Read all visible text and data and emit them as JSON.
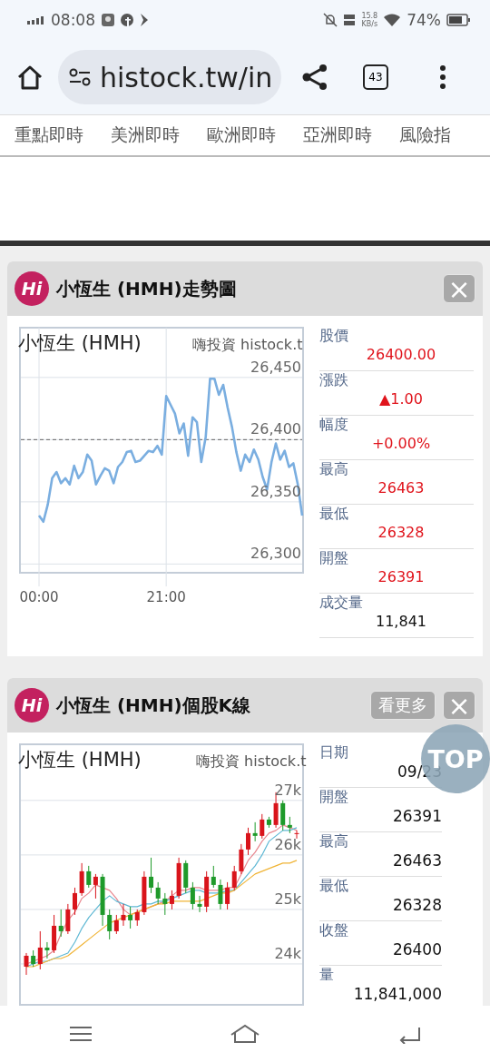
{
  "status_bar": {
    "time": "08:08",
    "speed_value": "15.8",
    "speed_unit": "KB/s",
    "battery": "74%"
  },
  "browser": {
    "url": "histock.tw/in",
    "tab_count": "43"
  },
  "nav_tabs": [
    {
      "label": "重點即時"
    },
    {
      "label": "美洲即時"
    },
    {
      "label": "歐洲即時"
    },
    {
      "label": "亞洲即時"
    },
    {
      "label": "風險指"
    }
  ],
  "cards": [
    {
      "kind": "trend",
      "logo_text": "Hi",
      "title": "小恆生 (HMH)走勢圖",
      "close": "×",
      "chart_credit": "嗨投資 histock.t",
      "chart_data": {
        "type": "line",
        "title": "小恆生 (HMH)",
        "grid": true,
        "ylim": [
          26293,
          26490
        ],
        "categories": [
          "00:00",
          null,
          null,
          null,
          null,
          null,
          null,
          null,
          null,
          null,
          null,
          null,
          null,
          null,
          null,
          null,
          null,
          null,
          null,
          null,
          null,
          null,
          null,
          null,
          null,
          null,
          null,
          null,
          null,
          "21:00",
          null,
          null,
          null,
          null,
          null,
          null,
          null,
          null,
          null,
          null,
          null,
          null,
          null,
          null,
          null,
          null,
          null,
          null,
          null,
          null,
          null,
          null,
          null,
          null,
          null,
          null,
          null,
          null,
          null,
          null,
          null
        ],
        "yticks": [
          {
            "value": 26300,
            "label": "26,300"
          },
          {
            "value": 26350,
            "label": "26,350"
          },
          {
            "value": 26400,
            "label": "26,400"
          },
          {
            "value": 26450,
            "label": "26,450"
          }
        ],
        "ref_lines": [
          {
            "axis": "y",
            "value": 26400
          }
        ],
        "series": [
          {
            "color": "#7aaee0",
            "values": [
              26339,
              26334,
              26348,
              26369,
              26374,
              26365,
              26369,
              26364,
              26379,
              26369,
              26374,
              26388,
              26383,
              26364,
              26371,
              26377,
              26375,
              26365,
              26378,
              26382,
              26390,
              26391,
              26382,
              26383,
              26387,
              26391,
              26390,
              26395,
              26388,
              26435,
              26428,
              26421,
              26405,
              26413,
              26387,
              26418,
              26414,
              26382,
              26402,
              26449,
              26449,
              26436,
              26444,
              26426,
              26410,
              26390,
              26375,
              26388,
              26382,
              26392,
              26384,
              26370,
              26360,
              26382,
              26397,
              26384,
              26391,
              26378,
              26381,
              26364,
              26339
            ]
          }
        ]
      },
      "stats": [
        {
          "label": "股價",
          "value": "26400.00",
          "color": "#e0141c"
        },
        {
          "label": "漲跌",
          "value": "▲1.00",
          "color": "#e0141c"
        },
        {
          "label": "幅度",
          "value": "+0.00%",
          "color": "#e0141c"
        },
        {
          "label": "最高",
          "value": "26463",
          "color": "#e0141c"
        },
        {
          "label": "最低",
          "value": "26328",
          "color": "#e0141c"
        },
        {
          "label": "開盤",
          "value": "26391",
          "color": "#e0141c"
        },
        {
          "label": "成交量",
          "value": "11,841",
          "color": "#111111"
        }
      ]
    },
    {
      "kind": "kline",
      "logo_text": "Hi",
      "title": "小恆生 (HMH)個股K線",
      "more": "看更多",
      "close": "×",
      "chart_credit": "嗨投資 histock.t",
      "chart_data": {
        "type": "candlestick",
        "title": "小恆生 (HMH)",
        "grid": true,
        "ylim": [
          23250,
          28030
        ],
        "categories": [
          null,
          null,
          null,
          null,
          null,
          null,
          null,
          null,
          null,
          null,
          null,
          null,
          null,
          null,
          null,
          null,
          null,
          null,
          null,
          null,
          null,
          null,
          null,
          null,
          null,
          null,
          null,
          null,
          null,
          null,
          null,
          null,
          null,
          null,
          null,
          null,
          null,
          null,
          null,
          null
        ],
        "yticks": [
          {
            "value": 24000,
            "label": "24k"
          },
          {
            "value": 25000,
            "label": "25k"
          },
          {
            "value": 26000,
            "label": "26k"
          },
          {
            "value": 27000,
            "label": "27k"
          }
        ],
        "ohlc": [
          [
            23950,
            24200,
            23800,
            24150
          ],
          [
            24150,
            24250,
            23950,
            24000
          ],
          [
            24000,
            24600,
            23900,
            24300
          ],
          [
            24300,
            24400,
            24100,
            24250
          ],
          [
            24250,
            24900,
            24200,
            24700
          ],
          [
            24700,
            25000,
            24500,
            24600
          ],
          [
            24600,
            25100,
            24550,
            25000
          ],
          [
            25000,
            25400,
            24900,
            25300
          ],
          [
            25300,
            25850,
            25250,
            25700
          ],
          [
            25700,
            25800,
            25400,
            25450
          ],
          [
            25450,
            25650,
            25200,
            25600
          ],
          [
            25600,
            25650,
            24700,
            24900
          ],
          [
            24900,
            25000,
            24450,
            24600
          ],
          [
            24600,
            24900,
            24550,
            24800
          ],
          [
            24800,
            25100,
            24700,
            24900
          ],
          [
            24900,
            25050,
            24650,
            24800
          ],
          [
            24800,
            25000,
            24700,
            24950
          ],
          [
            24950,
            25700,
            24900,
            25600
          ],
          [
            25600,
            25950,
            25300,
            25400
          ],
          [
            25400,
            25500,
            25100,
            25200
          ],
          [
            25200,
            25300,
            24900,
            25100
          ],
          [
            25100,
            25350,
            25000,
            25250
          ],
          [
            25250,
            25950,
            25200,
            25850
          ],
          [
            25850,
            25900,
            25300,
            25400
          ],
          [
            25400,
            25500,
            25000,
            25100
          ],
          [
            25100,
            25250,
            24950,
            25050
          ],
          [
            25050,
            25700,
            24950,
            25600
          ],
          [
            25600,
            25800,
            25400,
            25450
          ],
          [
            25450,
            25550,
            25000,
            25100
          ],
          [
            25100,
            25500,
            25000,
            25400
          ],
          [
            25400,
            25800,
            25350,
            25700
          ],
          [
            25700,
            26200,
            25650,
            26100
          ],
          [
            26100,
            26500,
            26000,
            26400
          ],
          [
            26400,
            26600,
            26250,
            26350
          ],
          [
            26350,
            26750,
            26300,
            26650
          ],
          [
            26650,
            26700,
            26500,
            26550
          ],
          [
            26550,
            27150,
            26500,
            26950
          ],
          [
            26950,
            27000,
            26450,
            26550
          ],
          [
            26550,
            26700,
            26400,
            26500
          ],
          [
            26400,
            26450,
            26300,
            26400
          ]
        ],
        "series": [
          {
            "type": "line",
            "color": "#e8868e",
            "values": [
              24000,
              24050,
              24100,
              24150,
              24250,
              24550,
              24800,
              24950,
              25200,
              25300,
              25450,
              25400,
              25350,
              25200,
              25000,
              24900,
              24950,
              25000,
              25050,
              25100,
              25150,
              25250,
              25350,
              25350,
              25400,
              25400,
              25350,
              25350,
              25350,
              25400,
              25400,
              25650,
              25900,
              26050,
              26250,
              26400,
              26450,
              26550,
              26500,
              26450
            ]
          },
          {
            "type": "line",
            "color": "#5fb8d4",
            "values": [
              23950,
              24000,
              24050,
              24050,
              24100,
              24150,
              24200,
              24400,
              24650,
              24850,
              25000,
              25150,
              25250,
              25150,
              25100,
              25050,
              25050,
              25100,
              25100,
              25150,
              25150,
              25200,
              25250,
              25300,
              25350,
              25350,
              25300,
              25300,
              25300,
              25350,
              25350,
              25500,
              25650,
              25800,
              26000,
              26250,
              26350,
              26450,
              26450,
              26500
            ]
          },
          {
            "type": "line",
            "color": "#f0b436",
            "values": [
              23950,
              23950,
              24000,
              24050,
              24100,
              24100,
              24150,
              24250,
              24350,
              24450,
              24550,
              24650,
              24750,
              24800,
              24850,
              24900,
              24950,
              25000,
              25050,
              25100,
              25100,
              25150,
              25150,
              25150,
              25150,
              25150,
              25200,
              25250,
              25300,
              25300,
              25350,
              25450,
              25550,
              25650,
              25700,
              25750,
              25800,
              25850,
              25850,
              25900
            ]
          }
        ]
      },
      "stats": [
        {
          "label": "日期",
          "value": "09/23",
          "color": "#111111"
        },
        {
          "label": "開盤",
          "value": "26391",
          "color": "#111111"
        },
        {
          "label": "最高",
          "value": "26463",
          "color": "#111111"
        },
        {
          "label": "最低",
          "value": "26328",
          "color": "#111111"
        },
        {
          "label": "收盤",
          "value": "26400",
          "color": "#111111"
        },
        {
          "label": "量",
          "value": "11,841,000",
          "color": "#111111"
        }
      ]
    }
  ],
  "top_button": {
    "label": "TOP"
  }
}
